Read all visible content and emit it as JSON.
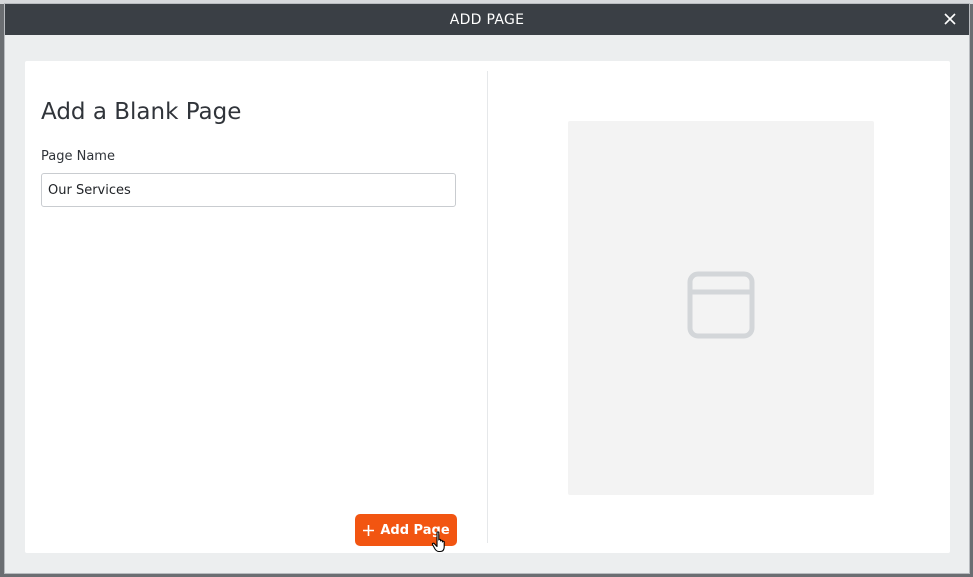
{
  "modal": {
    "title": "ADD PAGE",
    "close_icon": "close-icon"
  },
  "form": {
    "heading": "Add a Blank Page",
    "field_label": "Page Name",
    "page_name_value": "Our Services",
    "add_button_label": "Add Page",
    "add_button_icon": "plus-icon"
  },
  "preview": {
    "icon": "blank-page-icon"
  },
  "colors": {
    "header_bg": "#3a3f45",
    "accent": "#f25511",
    "preview_bg": "#f3f3f3"
  }
}
